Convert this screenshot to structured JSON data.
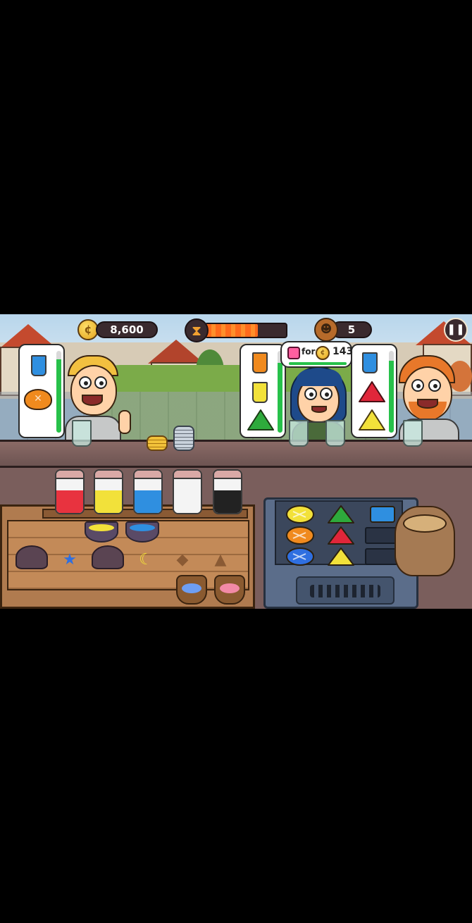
{
  "hud": {
    "coins": "8,600",
    "timer_fraction": 0.65,
    "customers_served": "5",
    "coin_icon": "coin-icon",
    "timer_icon": "hourglass-icon",
    "customer_icon": "customer-icon",
    "pause_icon": "pause-icon"
  },
  "offer": {
    "label": "for",
    "price": "143",
    "gem_color": "#ff5fa0"
  },
  "orders": [
    {
      "customer": "blond-boy",
      "patience": 0.9,
      "items": [
        {
          "kind": "drink",
          "color": "#2f8fe0"
        },
        {
          "kind": "bun",
          "shape": "round",
          "color": "#f08a1e"
        }
      ]
    },
    {
      "customer": "blue-haired-girl",
      "patience": 0.85,
      "items": [
        {
          "kind": "drink",
          "color": "#f08a1e"
        },
        {
          "kind": "drink",
          "color": "#f2e13a"
        },
        {
          "kind": "bun",
          "shape": "triangle",
          "color": "#2eaa3c"
        }
      ]
    },
    {
      "customer": "ginger-man",
      "patience": 0.88,
      "items": [
        {
          "kind": "drink",
          "color": "#2f8fe0"
        },
        {
          "kind": "bun",
          "shape": "triangle",
          "color": "#e0263a"
        },
        {
          "kind": "bun",
          "shape": "triangle",
          "color": "#f2e13a"
        }
      ]
    }
  ],
  "station": {
    "jars": [
      "#e8333f",
      "#f2e13a",
      "#2f8fe0",
      "#f4f4f4",
      "#222222"
    ],
    "bowls": [
      "#f2e13a",
      "#2f8fe0"
    ],
    "stamps": [
      "star",
      "moon",
      "diamond",
      "triangle"
    ],
    "stamp_colors": [
      "#2f6fe0",
      "#f2e13a",
      "#8a5a34",
      "#8a5a34"
    ]
  },
  "oven": {
    "cells": [
      {
        "shape": "round",
        "color": "#f2e13a"
      },
      {
        "shape": "triangle",
        "color": "#2eaa3c"
      },
      {
        "shape": "square",
        "color": "#2f8fe0"
      },
      {
        "shape": "round",
        "color": "#f08a1e"
      },
      {
        "shape": "triangle",
        "color": "#e0263a"
      },
      {
        "shape": "empty",
        "color": ""
      },
      {
        "shape": "round",
        "color": "#2f6fe0"
      },
      {
        "shape": "triangle",
        "color": "#f2e13a"
      },
      {
        "shape": "empty",
        "color": ""
      }
    ]
  }
}
